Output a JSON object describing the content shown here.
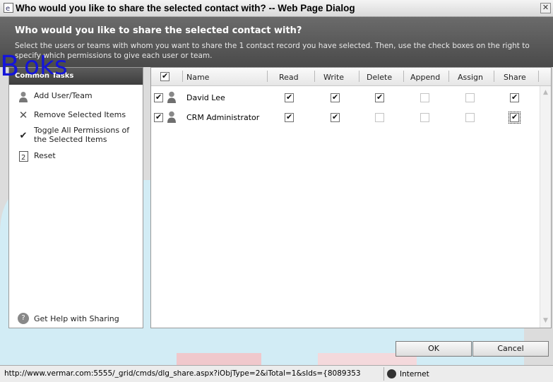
{
  "window": {
    "title": "Who would you like to share the selected contact with? -- Web Page Dialog",
    "close_icon": "close-icon"
  },
  "header": {
    "title": "Who would you like to share the selected contact with?",
    "description": "Select the users or teams with whom you want to share the 1 contact record you have selected. Then, use the check boxes on the right to specify which permissions to give each user or team."
  },
  "overlay": {
    "text1": "B",
    "text2": "oks"
  },
  "tasks_panel": {
    "heading": "Common Tasks",
    "items": [
      {
        "label": "Add User/Team",
        "icon": "user-icon"
      },
      {
        "label": "Remove Selected Items",
        "icon": "x-icon"
      },
      {
        "label": "Toggle All Permissions of the Selected Items",
        "icon": "check-icon"
      },
      {
        "label": "Reset",
        "icon": "reset-icon"
      }
    ],
    "help": {
      "label": "Get Help with Sharing",
      "icon": "help-icon"
    }
  },
  "grid": {
    "columns": [
      "Name",
      "Read",
      "Write",
      "Delete",
      "Append",
      "Assign",
      "Share"
    ],
    "rows": [
      {
        "name": "David Lee",
        "selected": true,
        "read": true,
        "write": true,
        "delete": true,
        "append": false,
        "assign": false,
        "share": true
      },
      {
        "name": "CRM Administrator",
        "selected": true,
        "read": true,
        "write": true,
        "delete": false,
        "append": false,
        "assign": false,
        "share": true
      }
    ]
  },
  "buttons": {
    "ok": "OK",
    "cancel": "Cancel"
  },
  "statusbar": {
    "url": "http://www.vermar.com:5555/_grid/cmds/dlg_share.aspx?iObjType=2&iTotal=1&sIds={8089353",
    "zone": "Internet"
  },
  "colors": {
    "header": "#555555",
    "overlay_text": "#1515d9",
    "watermark": "#d2ecf5"
  }
}
